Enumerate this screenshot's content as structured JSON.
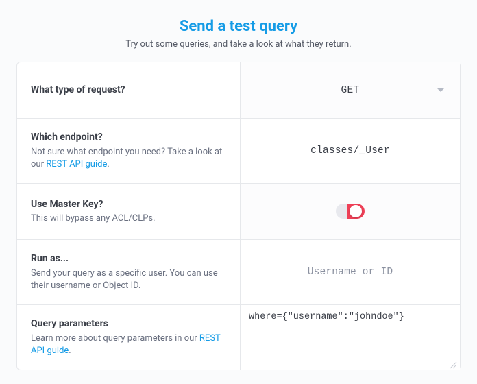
{
  "header": {
    "title": "Send a test query",
    "subtitle": "Try out some queries, and take a look at what they return."
  },
  "rows": {
    "request_type": {
      "label": "What type of request?",
      "value": "GET"
    },
    "endpoint": {
      "label": "Which endpoint?",
      "desc_prefix": "Not sure what endpoint you need? Take a look at our ",
      "link_text": "REST API guide",
      "desc_suffix": ".",
      "value": "classes/_User"
    },
    "master_key": {
      "label": "Use Master Key?",
      "desc": "This will bypass any ACL/CLPs.",
      "value": true
    },
    "run_as": {
      "label": "Run as...",
      "desc": "Send your query as a specific user. You can use their username or Object ID.",
      "placeholder": "Username or ID",
      "value": ""
    },
    "query_params": {
      "label": "Query parameters",
      "desc_prefix": "Learn more about query parameters in our ",
      "link_text": "REST API guide",
      "desc_suffix": ".",
      "value": "where={\"username\":\"johndoe\"}"
    }
  }
}
